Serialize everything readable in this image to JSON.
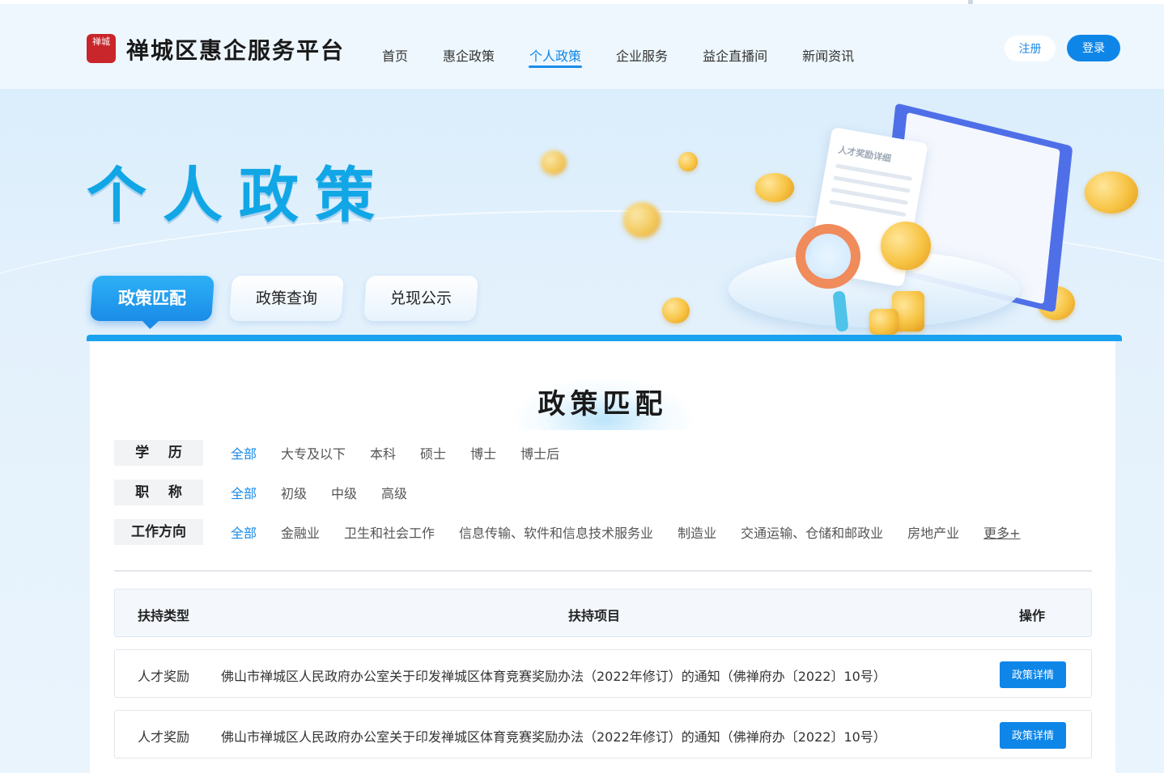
{
  "header": {
    "logo_mark": "禅城",
    "site_title": "禅城区惠企服务平台",
    "nav": [
      "首页",
      "惠企政策",
      "个人政策",
      "企业服务",
      "益企直播间",
      "新闻资讯"
    ],
    "active_nav": "个人政策",
    "register_label": "注册",
    "login_label": "登录"
  },
  "banner": {
    "hero_title": "个人政策",
    "paper_caption": "人才奖励详细"
  },
  "tabs": [
    "政策匹配",
    "政策查询",
    "兑现公示"
  ],
  "active_tab": "政策匹配",
  "section_title": "政策匹配",
  "filters": [
    {
      "label": "学    历",
      "options": [
        "全部",
        "大专及以下",
        "本科",
        "硕士",
        "博士",
        "博士后"
      ],
      "selected": "全部"
    },
    {
      "label": "职    称",
      "options": [
        "全部",
        "初级",
        "中级",
        "高级"
      ],
      "selected": "全部"
    },
    {
      "label": "工作方向",
      "options": [
        "全部",
        "金融业",
        "卫生和社会工作",
        "信息传输、软件和信息技术服务业",
        "制造业",
        "交通运输、仓储和邮政业",
        "房地产业"
      ],
      "selected": "全部",
      "more_label": "更多+"
    }
  ],
  "table": {
    "headers": {
      "type": "扶持类型",
      "item": "扶持项目",
      "op": "操作"
    },
    "rows": [
      {
        "type": "人才奖励",
        "item": "佛山市禅城区人民政府办公室关于印发禅城区体育竞赛奖励办法（2022年修订）的通知（佛禅府办〔2022〕10号）",
        "action": "政策详情"
      },
      {
        "type": "人才奖励",
        "item": "佛山市禅城区人民政府办公室关于印发禅城区体育竞赛奖励办法（2022年修订）的通知（佛禅府办〔2022〕10号）",
        "action": "政策详情"
      }
    ]
  },
  "colors": {
    "primary": "#0e86e8",
    "accent": "#11a6e6",
    "logo_red": "#c9262b"
  }
}
